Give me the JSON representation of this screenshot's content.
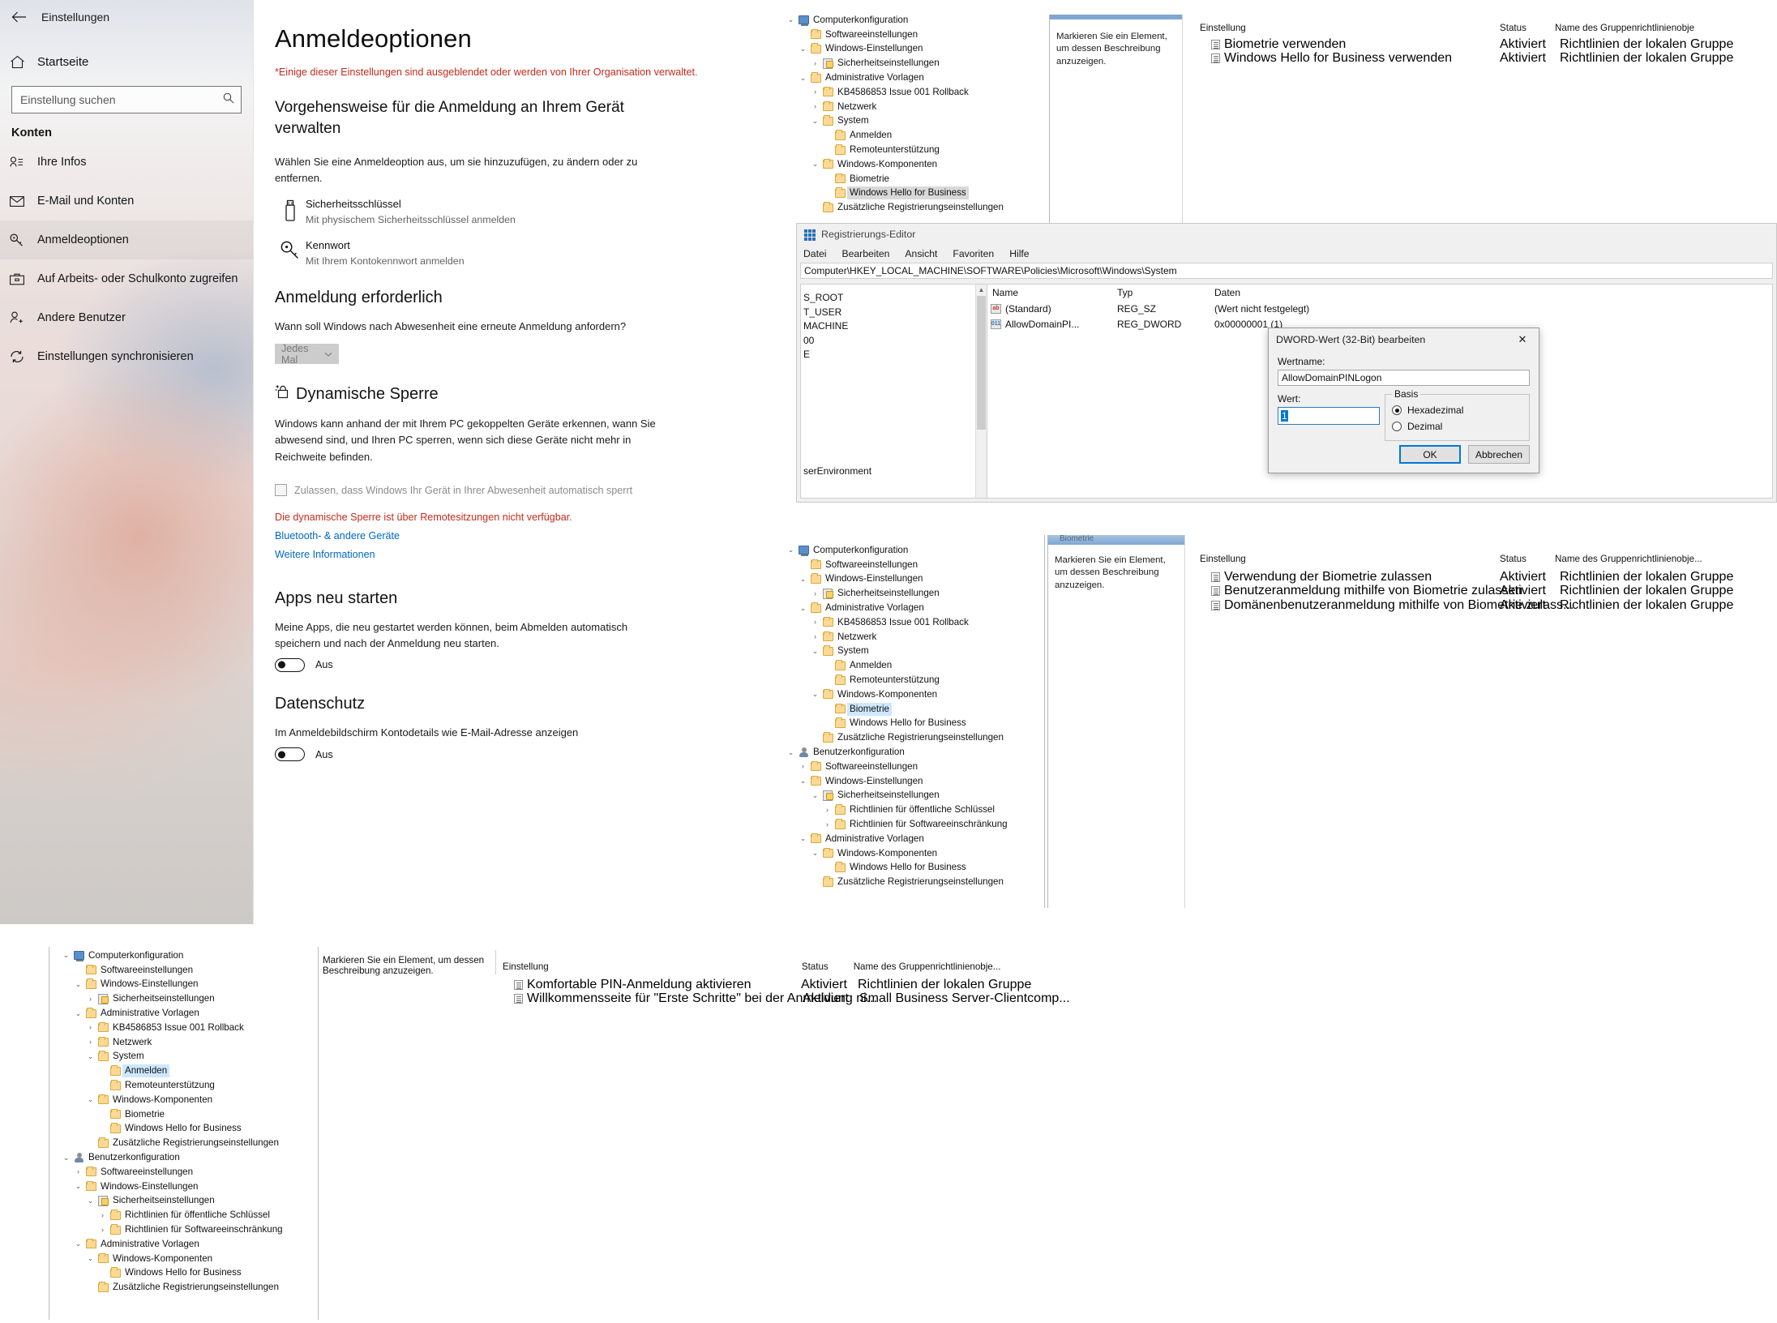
{
  "settings": {
    "window_title": "Einstellungen",
    "back_label": "←",
    "home_label": "Startseite",
    "search_placeholder": "Einstellung suchen",
    "section_label": "Konten",
    "nav_items": [
      {
        "label": "Ihre Infos",
        "icon": "user-info-icon"
      },
      {
        "label": "E-Mail und Konten",
        "icon": "mail-icon"
      },
      {
        "label": "Anmeldeoptionen",
        "icon": "key-icon"
      },
      {
        "label": "Auf Arbeits- oder Schulkonto zugreifen",
        "icon": "briefcase-icon"
      },
      {
        "label": "Andere Benutzer",
        "icon": "add-user-icon"
      },
      {
        "label": "Einstellungen synchronisieren",
        "icon": "sync-icon"
      }
    ],
    "page_title": "Anmeldeoptionen",
    "managed_warning": "*Einige dieser Einstellungen sind ausgeblendet oder werden von Ihrer Organisation verwaltet.",
    "manage_heading": "Vorgehensweise für die Anmeldung an Ihrem Gerät verwalten",
    "manage_body": "Wählen Sie eine Anmeldeoption aus, um sie hinzuzufügen, zu ändern oder zu entfernen.",
    "signin_options": [
      {
        "title": "Sicherheitsschlüssel",
        "subtitle": "Mit physischem Sicherheitsschlüssel anmelden",
        "icon": "usb-security-key-icon"
      },
      {
        "title": "Kennwort",
        "subtitle": "Mit Ihrem Kontokennwort anmelden",
        "icon": "key-icon"
      }
    ],
    "required_heading": "Anmeldung erforderlich",
    "required_body": "Wann soll Windows nach Abwesenheit eine erneute Anmeldung anfordern?",
    "required_dropdown_value": "Jedes Mal",
    "dynamic_lock_heading": "Dynamische Sperre",
    "dynamic_lock_body": "Windows kann anhand der mit Ihrem PC gekoppelten Geräte erkennen, wann Sie abwesend sind, und Ihren PC sperren, wenn sich diese Geräte nicht mehr in Reichweite befinden.",
    "dynamic_lock_checkbox": "Zulassen, dass Windows Ihr Gerät in Ihrer Abwesenheit automatisch sperrt",
    "dynamic_lock_warning": "Die dynamische Sperre ist über Remotesitzungen nicht verfügbar.",
    "link_bluetooth": "Bluetooth- & andere Geräte",
    "link_more": "Weitere Informationen",
    "restart_heading": "Apps neu starten",
    "restart_body": "Meine Apps, die neu gestartet werden können, beim Abmelden automatisch speichern und nach der Anmeldung neu starten.",
    "restart_toggle": "Aus",
    "privacy_heading": "Datenschutz",
    "privacy_body": "Im Anmeldebildschirm Kontodetails wie E-Mail-Adresse anzeigen",
    "privacy_toggle": "Aus"
  },
  "gpedit_top": {
    "tree": [
      {
        "label": "Computerkonfiguration",
        "indent": 0,
        "chev": "down",
        "icon": "computer-icon"
      },
      {
        "label": "Softwareeinstellungen",
        "indent": 1,
        "chev": "",
        "icon": "folder-icon"
      },
      {
        "label": "Windows-Einstellungen",
        "indent": 1,
        "chev": "down",
        "icon": "folder-icon"
      },
      {
        "label": "Sicherheitseinstellungen",
        "indent": 2,
        "chev": "right",
        "icon": "security-icon"
      },
      {
        "label": "Administrative Vorlagen",
        "indent": 1,
        "chev": "down",
        "icon": "folder-icon"
      },
      {
        "label": "KB4586853 Issue 001 Rollback",
        "indent": 2,
        "chev": "right",
        "icon": "folder-icon"
      },
      {
        "label": "Netzwerk",
        "indent": 2,
        "chev": "right",
        "icon": "folder-icon"
      },
      {
        "label": "System",
        "indent": 2,
        "chev": "down",
        "icon": "folder-icon"
      },
      {
        "label": "Anmelden",
        "indent": 3,
        "chev": "",
        "icon": "folder-icon"
      },
      {
        "label": "Remoteunterstützung",
        "indent": 3,
        "chev": "",
        "icon": "folder-icon"
      },
      {
        "label": "Windows-Komponenten",
        "indent": 2,
        "chev": "down",
        "icon": "folder-icon"
      },
      {
        "label": "Biometrie",
        "indent": 3,
        "chev": "",
        "icon": "folder-icon"
      },
      {
        "label": "Windows Hello for Business",
        "indent": 3,
        "chev": "",
        "icon": "folder-icon",
        "selected": "gray"
      },
      {
        "label": "Zusätzliche Registrierungseinstellungen",
        "indent": 2,
        "chev": "",
        "icon": "folder-icon"
      }
    ],
    "description": "Markieren Sie ein Element, um dessen Beschreibung anzuzeigen.",
    "columns": {
      "setting": "Einstellung",
      "status": "Status",
      "gpo": "Name des Gruppenrichtlinienobje"
    },
    "rows": [
      {
        "setting": "Biometrie verwenden",
        "status": "Aktiviert",
        "gpo": "Richtlinien der lokalen Gruppe",
        "icon": "policy-bio-icon"
      },
      {
        "setting": "Windows Hello for Business verwenden",
        "status": "Aktiviert",
        "gpo": "Richtlinien der lokalen Gruppe",
        "icon": "policy-icon"
      }
    ]
  },
  "gpedit_mid": {
    "tree": [
      {
        "label": "Computerkonfiguration",
        "indent": 0,
        "chev": "down",
        "icon": "computer-icon"
      },
      {
        "label": "Softwareeinstellungen",
        "indent": 1,
        "chev": "",
        "icon": "folder-icon"
      },
      {
        "label": "Windows-Einstellungen",
        "indent": 1,
        "chev": "down",
        "icon": "folder-icon"
      },
      {
        "label": "Sicherheitseinstellungen",
        "indent": 2,
        "chev": "right",
        "icon": "security-icon"
      },
      {
        "label": "Administrative Vorlagen",
        "indent": 1,
        "chev": "down",
        "icon": "folder-icon"
      },
      {
        "label": "KB4586853 Issue 001 Rollback",
        "indent": 2,
        "chev": "right",
        "icon": "folder-icon"
      },
      {
        "label": "Netzwerk",
        "indent": 2,
        "chev": "right",
        "icon": "folder-icon"
      },
      {
        "label": "System",
        "indent": 2,
        "chev": "down",
        "icon": "folder-icon"
      },
      {
        "label": "Anmelden",
        "indent": 3,
        "chev": "",
        "icon": "folder-icon"
      },
      {
        "label": "Remoteunterstützung",
        "indent": 3,
        "chev": "",
        "icon": "folder-icon"
      },
      {
        "label": "Windows-Komponenten",
        "indent": 2,
        "chev": "down",
        "icon": "folder-icon"
      },
      {
        "label": "Biometrie",
        "indent": 3,
        "chev": "",
        "icon": "folder-icon",
        "selected": "blue"
      },
      {
        "label": "Windows Hello for Business",
        "indent": 3,
        "chev": "",
        "icon": "folder-icon"
      },
      {
        "label": "Zusätzliche Registrierungseinstellungen",
        "indent": 2,
        "chev": "",
        "icon": "folder-icon"
      },
      {
        "label": "Benutzerkonfiguration",
        "indent": 0,
        "chev": "down",
        "icon": "user-icon"
      },
      {
        "label": "Softwareeinstellungen",
        "indent": 1,
        "chev": "right",
        "icon": "folder-icon"
      },
      {
        "label": "Windows-Einstellungen",
        "indent": 1,
        "chev": "down",
        "icon": "folder-icon"
      },
      {
        "label": "Sicherheitseinstellungen",
        "indent": 2,
        "chev": "down",
        "icon": "security-icon"
      },
      {
        "label": "Richtlinien für öffentliche Schlüssel",
        "indent": 3,
        "chev": "right",
        "icon": "folder-icon"
      },
      {
        "label": "Richtlinien für Softwareeinschränkung",
        "indent": 3,
        "chev": "right",
        "icon": "folder-icon"
      },
      {
        "label": "Administrative Vorlagen",
        "indent": 1,
        "chev": "down",
        "icon": "folder-icon"
      },
      {
        "label": "Windows-Komponenten",
        "indent": 2,
        "chev": "down",
        "icon": "folder-icon"
      },
      {
        "label": "Windows Hello for Business",
        "indent": 3,
        "chev": "",
        "icon": "folder-icon"
      },
      {
        "label": "Zusätzliche Registrierungseinstellungen",
        "indent": 2,
        "chev": "",
        "icon": "folder-icon"
      }
    ],
    "tab_label": "Biometrie",
    "description": "Markieren Sie ein Element, um dessen Beschreibung anzuzeigen.",
    "columns": {
      "setting": "Einstellung",
      "status": "Status",
      "gpo": "Name des Gruppenrichtlinienobje..."
    },
    "rows": [
      {
        "setting": "Verwendung der Biometrie zulassen",
        "status": "Aktiviert",
        "gpo": "Richtlinien der lokalen Gruppe",
        "icon": "policy-icon"
      },
      {
        "setting": "Benutzeranmeldung mithilfe von Biometrie zulassen",
        "status": "Aktiviert",
        "gpo": "Richtlinien der lokalen Gruppe",
        "icon": "policy-icon"
      },
      {
        "setting": "Domänenbenutzeranmeldung mithilfe von Biometrie zulass...",
        "status": "Aktiviert",
        "gpo": "Richtlinien der lokalen Gruppe",
        "icon": "policy-icon"
      }
    ]
  },
  "gpedit_bottom": {
    "tree": [
      {
        "label": "Computerkonfiguration",
        "indent": 0,
        "chev": "down",
        "icon": "computer-icon"
      },
      {
        "label": "Softwareeinstellungen",
        "indent": 1,
        "chev": "",
        "icon": "folder-icon"
      },
      {
        "label": "Windows-Einstellungen",
        "indent": 1,
        "chev": "down",
        "icon": "folder-icon"
      },
      {
        "label": "Sicherheitseinstellungen",
        "indent": 2,
        "chev": "right",
        "icon": "security-icon"
      },
      {
        "label": "Administrative Vorlagen",
        "indent": 1,
        "chev": "down",
        "icon": "folder-icon"
      },
      {
        "label": "KB4586853 Issue 001 Rollback",
        "indent": 2,
        "chev": "right",
        "icon": "folder-icon"
      },
      {
        "label": "Netzwerk",
        "indent": 2,
        "chev": "right",
        "icon": "folder-icon"
      },
      {
        "label": "System",
        "indent": 2,
        "chev": "down",
        "icon": "folder-icon"
      },
      {
        "label": "Anmelden",
        "indent": 3,
        "chev": "",
        "icon": "folder-icon",
        "selected": "blue"
      },
      {
        "label": "Remoteunterstützung",
        "indent": 3,
        "chev": "",
        "icon": "folder-icon"
      },
      {
        "label": "Windows-Komponenten",
        "indent": 2,
        "chev": "down",
        "icon": "folder-icon"
      },
      {
        "label": "Biometrie",
        "indent": 3,
        "chev": "",
        "icon": "folder-icon"
      },
      {
        "label": "Windows Hello for Business",
        "indent": 3,
        "chev": "",
        "icon": "folder-icon"
      },
      {
        "label": "Zusätzliche Registrierungseinstellungen",
        "indent": 2,
        "chev": "",
        "icon": "folder-icon"
      },
      {
        "label": "Benutzerkonfiguration",
        "indent": 0,
        "chev": "down",
        "icon": "user-icon"
      },
      {
        "label": "Softwareeinstellungen",
        "indent": 1,
        "chev": "right",
        "icon": "folder-icon"
      },
      {
        "label": "Windows-Einstellungen",
        "indent": 1,
        "chev": "down",
        "icon": "folder-icon"
      },
      {
        "label": "Sicherheitseinstellungen",
        "indent": 2,
        "chev": "down",
        "icon": "security-icon"
      },
      {
        "label": "Richtlinien für öffentliche Schlüssel",
        "indent": 3,
        "chev": "right",
        "icon": "folder-icon"
      },
      {
        "label": "Richtlinien für Softwareeinschränkung",
        "indent": 3,
        "chev": "right",
        "icon": "folder-icon"
      },
      {
        "label": "Administrative Vorlagen",
        "indent": 1,
        "chev": "down",
        "icon": "folder-icon"
      },
      {
        "label": "Windows-Komponenten",
        "indent": 2,
        "chev": "down",
        "icon": "folder-icon"
      },
      {
        "label": "Windows Hello for Business",
        "indent": 3,
        "chev": "",
        "icon": "folder-icon"
      },
      {
        "label": "Zusätzliche Registrierungseinstellungen",
        "indent": 2,
        "chev": "",
        "icon": "folder-icon"
      }
    ],
    "description": "Markieren Sie ein Element, um dessen Beschreibung anzuzeigen.",
    "columns": {
      "setting": "Einstellung",
      "status": "Status",
      "gpo": "Name des Gruppenrichtlinienobje..."
    },
    "rows": [
      {
        "setting": "Komfortable PIN-Anmeldung aktivieren",
        "status": "Aktiviert",
        "gpo": "Richtlinien der lokalen Gruppe",
        "icon": "policy-icon"
      },
      {
        "setting": "Willkommensseite für \"Erste Schritte\" bei der Anmeldung ni...",
        "status": "Aktiviert",
        "gpo": "Small Business Server-Clientcomp...",
        "icon": "policy-icon"
      }
    ]
  },
  "regedit": {
    "title": "Registrierungs-Editor",
    "icon": "registry-icon",
    "menus": [
      "Datei",
      "Bearbeiten",
      "Ansicht",
      "Favoriten",
      "Hilfe"
    ],
    "address": "Computer\\HKEY_LOCAL_MACHINE\\SOFTWARE\\Policies\\Microsoft\\Windows\\System",
    "tree_keys": [
      "S_ROOT",
      "T_USER",
      "MACHINE",
      "00",
      "E",
      "serEnvironment"
    ],
    "columns": {
      "name": "Name",
      "type": "Typ",
      "data": "Daten"
    },
    "values": [
      {
        "name": "(Standard)",
        "type": "REG_SZ",
        "data": "(Wert nicht festgelegt)",
        "icon": "string-value-icon",
        "glyph": "ab"
      },
      {
        "name": "AllowDomainPI...",
        "type": "REG_DWORD",
        "data": "0x00000001 (1)",
        "icon": "dword-value-icon",
        "glyph": "011"
      }
    ]
  },
  "dword_dialog": {
    "title": "DWORD-Wert (32-Bit) bearbeiten",
    "close_label": "✕",
    "name_label": "Wertname:",
    "name_value": "AllowDomainPINLogon",
    "value_label": "Wert:",
    "value_value": "1",
    "base_legend": "Basis",
    "base_options": [
      "Hexadezimal",
      "Dezimal"
    ],
    "base_selected": "Hexadezimal",
    "ok_label": "OK",
    "cancel_label": "Abbrechen"
  }
}
